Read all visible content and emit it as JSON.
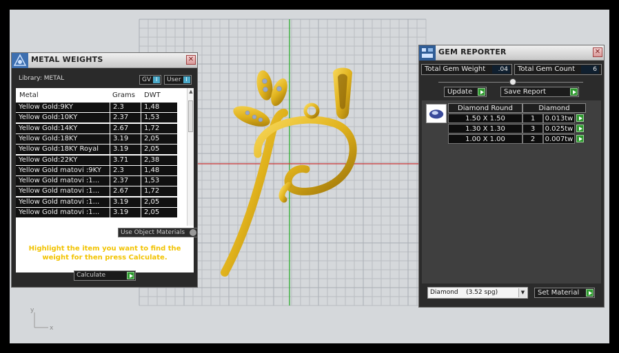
{
  "metal_weights": {
    "title": "METAL WEIGHTS",
    "library_label": "Library: METAL",
    "toggle_gv": "GV",
    "toggle_user": "User",
    "columns": [
      "Metal",
      "Grams",
      "DWT"
    ],
    "rows": [
      [
        "Yellow Gold:9KY",
        "2.3",
        "1,48"
      ],
      [
        "Yellow Gold:10KY",
        "2.37",
        "1,53"
      ],
      [
        "Yellow Gold:14KY",
        "2.67",
        "1,72"
      ],
      [
        "Yellow Gold:18KY",
        "3.19",
        "2,05"
      ],
      [
        "Yellow Gold:18KY Royal",
        "3.19",
        "2,05"
      ],
      [
        "Yellow Gold:22KY",
        "3.71",
        "2,38"
      ],
      [
        "Yellow Gold matovi :9KY",
        "2.3",
        "1,48"
      ],
      [
        "Yellow Gold matovi :1...",
        "2.37",
        "1,53"
      ],
      [
        "Yellow Gold matovi :1...",
        "2.67",
        "1,72"
      ],
      [
        "Yellow Gold matovi :1...",
        "3.19",
        "2,05"
      ],
      [
        "Yellow Gold matovi :1...",
        "3.19",
        "2,05"
      ]
    ],
    "use_object_materials": "Use Object Materials",
    "hint": "Highlight the item you want to find the weight for then press Calculate.",
    "calculate_label": "Calculate"
  },
  "gem_reporter": {
    "title": "GEM REPORTER",
    "total_gem_weight_label": "Total Gem Weight",
    "total_gem_weight_value": ".04",
    "total_gem_count_label": "Total Gem Count",
    "total_gem_count_value": "6",
    "update_label": "Update",
    "save_report_label": "Save Report",
    "gem_cut": "Diamond Round",
    "gem_material": "Diamond",
    "gem_rows": [
      [
        "1.50 X 1.50",
        "1",
        "0.013tw"
      ],
      [
        "1.30 X 1.30",
        "3",
        "0.025tw"
      ],
      [
        "1.00 X 1.00",
        "2",
        "0.007tw"
      ]
    ],
    "material_select": "Diamond    (3.52 spg)",
    "set_material_label": "Set Material"
  },
  "viewport": {
    "axis_y": "y",
    "axis_x": "x"
  },
  "colors": {
    "gold": "#e0b21c",
    "hint_text": "#f2c300",
    "axis_green": "#22aa22",
    "axis_red": "#cc3333"
  }
}
